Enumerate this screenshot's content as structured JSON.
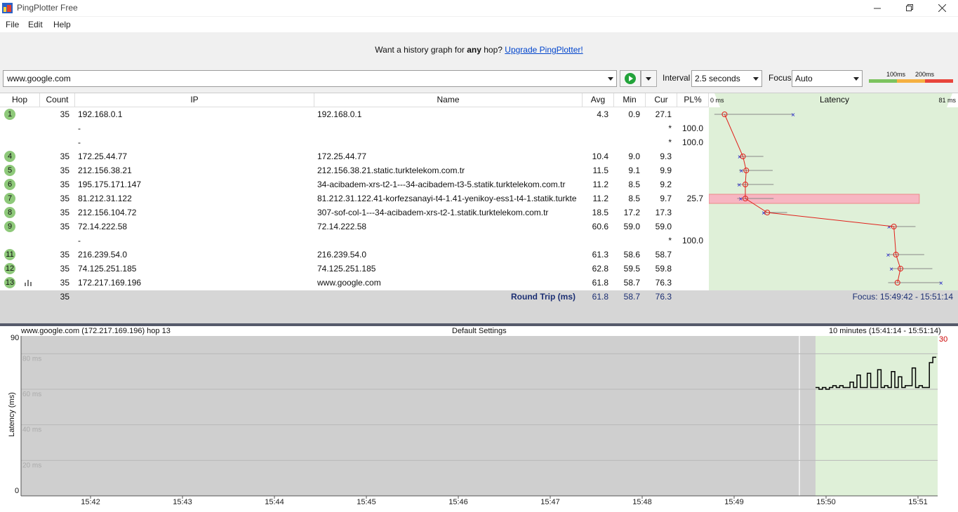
{
  "app": {
    "title": "PingPlotter Free",
    "menu": [
      "File",
      "Edit",
      "Help"
    ]
  },
  "banner": {
    "prefix": "Want a history graph for ",
    "bold": "any",
    "middle": " hop? ",
    "link": "Upgrade PingPlotter!"
  },
  "toolbar": {
    "target": "www.google.com",
    "interval_label": "Interval",
    "interval_value": "2.5 seconds",
    "focus_label": "Focus",
    "focus_value": "Auto",
    "scale_100": "100ms",
    "scale_200": "200ms"
  },
  "table": {
    "headers": {
      "hop": "Hop",
      "count": "Count",
      "ip": "IP",
      "name": "Name",
      "avg": "Avg",
      "min": "Min",
      "cur": "Cur",
      "pl": "PL%",
      "latency": "Latency"
    },
    "latency_min_label": "0 ms",
    "latency_max_label": "81 ms",
    "rows": [
      {
        "hop": "1",
        "count": "35",
        "ip": "192.168.0.1",
        "name": "192.168.0.1",
        "avg": "4.3",
        "min": "0.9",
        "cur": "27.1",
        "pl": ""
      },
      {
        "hop": "",
        "count": "",
        "ip": "-",
        "name": "",
        "avg": "",
        "min": "",
        "cur": "*",
        "pl": "100.0"
      },
      {
        "hop": "",
        "count": "",
        "ip": "-",
        "name": "",
        "avg": "",
        "min": "",
        "cur": "*",
        "pl": "100.0"
      },
      {
        "hop": "4",
        "count": "35",
        "ip": "172.25.44.77",
        "name": "172.25.44.77",
        "avg": "10.4",
        "min": "9.0",
        "cur": "9.3",
        "pl": ""
      },
      {
        "hop": "5",
        "count": "35",
        "ip": "212.156.38.21",
        "name": "212.156.38.21.static.turktelekom.com.tr",
        "avg": "11.5",
        "min": "9.1",
        "cur": "9.9",
        "pl": ""
      },
      {
        "hop": "6",
        "count": "35",
        "ip": "195.175.171.147",
        "name": "34-acibadem-xrs-t2-1---34-acibadem-t3-5.statik.turktelekom.com.tr",
        "avg": "11.2",
        "min": "8.5",
        "cur": "9.2",
        "pl": ""
      },
      {
        "hop": "7",
        "count": "35",
        "ip": "81.212.31.122",
        "name": "81.212.31.122.41-korfezsanayi-t4-1.41-yenikoy-ess1-t4-1.statik.turktel",
        "avg": "11.2",
        "min": "8.5",
        "cur": "9.7",
        "pl": "25.7"
      },
      {
        "hop": "8",
        "count": "35",
        "ip": "212.156.104.72",
        "name": "307-sof-col-1---34-acibadem-xrs-t2-1.statik.turktelekom.com.tr",
        "avg": "18.5",
        "min": "17.2",
        "cur": "17.3",
        "pl": ""
      },
      {
        "hop": "9",
        "count": "35",
        "ip": "72.14.222.58",
        "name": "72.14.222.58",
        "avg": "60.6",
        "min": "59.0",
        "cur": "59.0",
        "pl": ""
      },
      {
        "hop": "",
        "count": "",
        "ip": "-",
        "name": "",
        "avg": "",
        "min": "",
        "cur": "*",
        "pl": "100.0"
      },
      {
        "hop": "11",
        "count": "35",
        "ip": "216.239.54.0",
        "name": "216.239.54.0",
        "avg": "61.3",
        "min": "58.6",
        "cur": "58.7",
        "pl": ""
      },
      {
        "hop": "12",
        "count": "35",
        "ip": "74.125.251.185",
        "name": "74.125.251.185",
        "avg": "62.8",
        "min": "59.5",
        "cur": "59.8",
        "pl": ""
      },
      {
        "hop": "13",
        "count": "35",
        "ip": "172.217.169.196",
        "name": "www.google.com",
        "avg": "61.8",
        "min": "58.7",
        "cur": "76.3",
        "pl": ""
      }
    ]
  },
  "summary": {
    "count": "35",
    "label": "Round Trip (ms)",
    "avg": "61.8",
    "min": "58.7",
    "cur": "76.3",
    "focus": "Focus: 15:49:42 - 15:51:14"
  },
  "graph": {
    "title_left": "www.google.com (172.217.169.196) hop 13",
    "title_center": "Default Settings",
    "title_right": "10 minutes (15:41:14 - 15:51:14)",
    "y_top_label": "90",
    "y_bottom_label": "0",
    "y_axis_title": "Latency (ms)",
    "right_marker": "30",
    "gridlines": [
      "80 ms",
      "60 ms",
      "40 ms",
      "20 ms"
    ],
    "x_ticks": [
      "15:42",
      "15:43",
      "15:44",
      "15:45",
      "15:46",
      "15:47",
      "15:48",
      "15:49",
      "15:50",
      "15:51"
    ]
  },
  "colors": {
    "focus_green": "#dff0d8",
    "hop_badge": "#8ec97a",
    "loss_red": "#f7b6c2",
    "trace_red": "#e0201b",
    "min_marker_blue": "#1a1acc",
    "link_blue": "#0044cc"
  },
  "chart_data": {
    "type": "line",
    "xlabel": "",
    "ylabel": "Latency (ms)",
    "ylim": [
      0,
      90
    ],
    "x": [
      "15:49:45",
      "15:49:48",
      "15:49:50",
      "15:49:53",
      "15:49:55",
      "15:49:58",
      "15:50:00",
      "15:50:03",
      "15:50:05",
      "15:50:08",
      "15:50:10",
      "15:50:13",
      "15:50:15",
      "15:50:18",
      "15:50:20",
      "15:50:23",
      "15:50:25",
      "15:50:28",
      "15:50:30",
      "15:50:33",
      "15:50:35",
      "15:50:38",
      "15:50:40",
      "15:50:43",
      "15:50:45",
      "15:50:48",
      "15:50:50",
      "15:50:53",
      "15:50:55",
      "15:50:58",
      "15:51:00",
      "15:51:03",
      "15:51:05",
      "15:51:08",
      "15:51:10"
    ],
    "series": [
      {
        "values": [
          61,
          60,
          61,
          60,
          61,
          62,
          61,
          62,
          61,
          61,
          64,
          61,
          68,
          61,
          61,
          69,
          61,
          61,
          71,
          61,
          62,
          61,
          70,
          61,
          67,
          61,
          62,
          62,
          72,
          61,
          62,
          61,
          61,
          75,
          78
        ]
      }
    ]
  }
}
